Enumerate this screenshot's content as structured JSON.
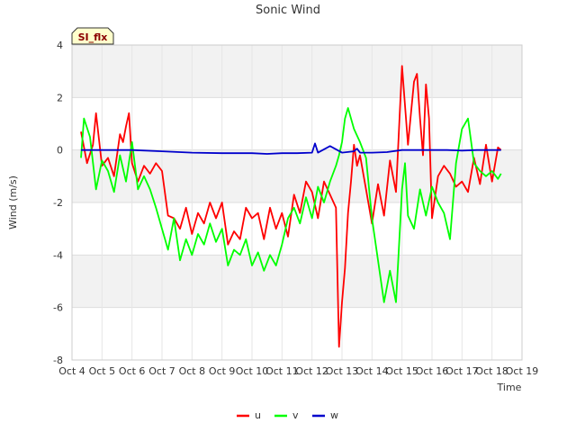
{
  "chart_data": {
    "type": "line",
    "title": "Sonic Wind",
    "badge": "SI_flx",
    "xlabel": "Time",
    "ylabel": "Wind (m/s)",
    "ylim": [
      -8,
      4
    ],
    "xlim": [
      0,
      15
    ],
    "yticks": [
      -8,
      -6,
      -4,
      -2,
      0,
      2,
      4
    ],
    "xticks": [
      "Oct 4",
      "Oct 5",
      "Oct 6",
      "Oct 7",
      "Oct 8",
      "Oct 9",
      "Oct 10",
      "Oct 11",
      "Oct 12",
      "Oct 13",
      "Oct 14",
      "Oct 15",
      "Oct 16",
      "Oct 17",
      "Oct 18",
      "Oct 19"
    ],
    "grid": true,
    "legend_position": "bottom",
    "series": [
      {
        "name": "u",
        "color": "#ff0000",
        "x": [
          0.3,
          0.5,
          0.7,
          0.8,
          0.9,
          1.0,
          1.2,
          1.4,
          1.6,
          1.7,
          1.8,
          1.9,
          2.0,
          2.2,
          2.4,
          2.6,
          2.8,
          3.0,
          3.2,
          3.4,
          3.6,
          3.8,
          4.0,
          4.2,
          4.4,
          4.6,
          4.8,
          5.0,
          5.2,
          5.4,
          5.6,
          5.8,
          6.0,
          6.2,
          6.4,
          6.6,
          6.8,
          7.0,
          7.2,
          7.4,
          7.6,
          7.8,
          8.0,
          8.2,
          8.4,
          8.6,
          8.8,
          8.9,
          9.0,
          9.1,
          9.2,
          9.3,
          9.4,
          9.5,
          9.6,
          9.8,
          10.0,
          10.2,
          10.4,
          10.6,
          10.8,
          11.0,
          11.2,
          11.4,
          11.5,
          11.6,
          11.7,
          11.8,
          11.9,
          12.0,
          12.2,
          12.4,
          12.6,
          12.8,
          13.0,
          13.2,
          13.4,
          13.6,
          13.8,
          14.0,
          14.2,
          14.3
        ],
        "values": [
          0.7,
          -0.5,
          0.2,
          1.4,
          0.4,
          -0.6,
          -0.3,
          -1.0,
          0.6,
          0.3,
          0.9,
          1.4,
          -0.5,
          -1.2,
          -0.6,
          -0.9,
          -0.5,
          -0.8,
          -2.5,
          -2.6,
          -3.0,
          -2.2,
          -3.2,
          -2.4,
          -2.8,
          -2.0,
          -2.6,
          -2.0,
          -3.6,
          -3.1,
          -3.4,
          -2.2,
          -2.6,
          -2.4,
          -3.4,
          -2.2,
          -3.0,
          -2.4,
          -3.3,
          -1.7,
          -2.4,
          -1.2,
          -1.6,
          -2.6,
          -1.2,
          -1.7,
          -2.2,
          -7.5,
          -5.8,
          -4.5,
          -2.4,
          -1.2,
          0.2,
          -0.6,
          -0.2,
          -1.5,
          -2.8,
          -1.3,
          -2.5,
          -0.4,
          -1.6,
          3.2,
          0.2,
          2.6,
          2.9,
          1.2,
          -0.2,
          2.5,
          1.2,
          -2.6,
          -1.0,
          -0.6,
          -0.9,
          -1.4,
          -1.2,
          -1.6,
          -0.3,
          -1.3,
          0.2,
          -1.2,
          0.1,
          0.0
        ]
      },
      {
        "name": "v",
        "color": "#00ff00",
        "x": [
          0.3,
          0.4,
          0.6,
          0.8,
          1.0,
          1.2,
          1.4,
          1.6,
          1.8,
          2.0,
          2.2,
          2.4,
          2.6,
          2.8,
          3.0,
          3.2,
          3.4,
          3.6,
          3.8,
          4.0,
          4.2,
          4.4,
          4.6,
          4.8,
          5.0,
          5.2,
          5.4,
          5.6,
          5.8,
          6.0,
          6.2,
          6.4,
          6.6,
          6.8,
          7.0,
          7.2,
          7.4,
          7.6,
          7.8,
          8.0,
          8.2,
          8.4,
          8.6,
          8.8,
          8.9,
          9.0,
          9.1,
          9.2,
          9.4,
          9.6,
          9.8,
          10.0,
          10.2,
          10.4,
          10.6,
          10.8,
          11.0,
          11.1,
          11.2,
          11.4,
          11.6,
          11.8,
          12.0,
          12.2,
          12.4,
          12.6,
          12.8,
          13.0,
          13.2,
          13.4,
          13.6,
          13.8,
          14.0,
          14.2,
          14.3
        ],
        "values": [
          -0.3,
          1.2,
          0.5,
          -1.5,
          -0.4,
          -0.8,
          -1.6,
          -0.2,
          -1.2,
          0.3,
          -1.5,
          -1.0,
          -1.5,
          -2.2,
          -3.0,
          -3.8,
          -2.6,
          -4.2,
          -3.4,
          -4.0,
          -3.2,
          -3.6,
          -2.8,
          -3.5,
          -3.0,
          -4.4,
          -3.8,
          -4.0,
          -3.4,
          -4.4,
          -3.9,
          -4.6,
          -4.0,
          -4.4,
          -3.6,
          -2.6,
          -2.2,
          -2.8,
          -1.8,
          -2.6,
          -1.4,
          -2.0,
          -1.2,
          -0.6,
          -0.2,
          0.3,
          1.2,
          1.6,
          0.8,
          0.3,
          -0.3,
          -2.6,
          -4.2,
          -5.8,
          -4.6,
          -5.8,
          -1.5,
          -0.5,
          -2.5,
          -3.0,
          -1.5,
          -2.5,
          -1.4,
          -2.0,
          -2.4,
          -3.4,
          -0.5,
          0.8,
          1.2,
          -0.5,
          -0.8,
          -1.0,
          -0.8,
          -1.1,
          -0.9
        ]
      },
      {
        "name": "w",
        "color": "#0000cc",
        "x": [
          0.3,
          1.0,
          2.0,
          3.0,
          4.0,
          5.0,
          5.5,
          6.0,
          6.5,
          7.0,
          7.5,
          8.0,
          8.1,
          8.2,
          8.6,
          9.0,
          9.4,
          9.5,
          9.6,
          10.0,
          10.5,
          11.0,
          11.5,
          12.0,
          12.5,
          13.0,
          13.5,
          14.0,
          14.3
        ],
        "values": [
          0.0,
          0.0,
          0.0,
          -0.05,
          -0.1,
          -0.12,
          -0.12,
          -0.12,
          -0.15,
          -0.12,
          -0.12,
          -0.1,
          0.25,
          -0.1,
          0.15,
          -0.1,
          -0.05,
          0.05,
          -0.1,
          -0.1,
          -0.08,
          0.0,
          0.0,
          0.0,
          0.0,
          -0.02,
          0.0,
          0.0,
          0.0
        ]
      }
    ]
  }
}
